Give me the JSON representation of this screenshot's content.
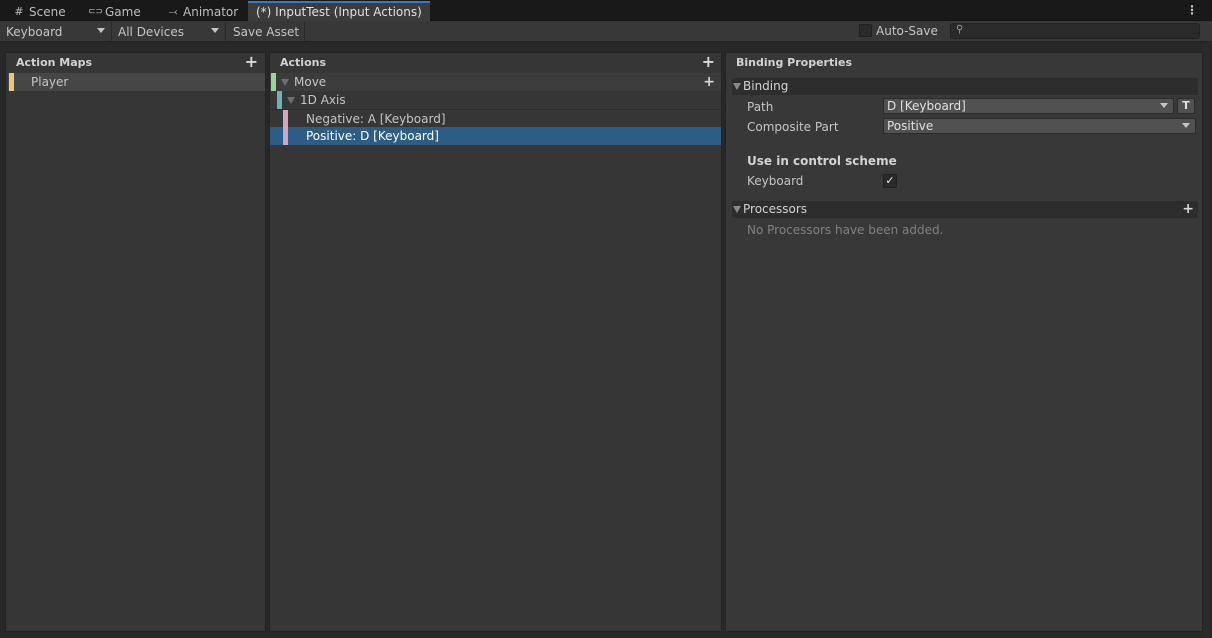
{
  "tabs": [
    {
      "icon": "#",
      "label": "Scene"
    },
    {
      "icon": "🎮",
      "label": "Game"
    },
    {
      "icon": "⤙",
      "label": "Animator"
    },
    {
      "icon": "",
      "label": "(*) InputTest (Input Actions)"
    }
  ],
  "toolbar": {
    "scheme_dropdown": "Keyboard",
    "device_dropdown": "All Devices",
    "save_button": "Save Asset",
    "autosave_label": "Auto-Save",
    "autosave_checked": false,
    "search_placeholder": ""
  },
  "action_maps": {
    "title": "Action Maps",
    "items": [
      {
        "label": "Player",
        "color": "#e8c97a"
      }
    ]
  },
  "actions": {
    "title": "Actions",
    "items": [
      {
        "label": "Move",
        "color": "#9ed19b"
      },
      {
        "label": "1D Axis",
        "color": "#6fb1b4"
      },
      {
        "label": "Negative: A [Keyboard]",
        "color": "#d4a4c0"
      },
      {
        "label": "Positive: D [Keyboard]",
        "color": "#d4a4c0",
        "selected": true
      }
    ]
  },
  "binding_properties": {
    "title": "Binding Properties",
    "binding_section": "Binding",
    "path_label": "Path",
    "path_value": "D [Keyboard]",
    "t_button": "T",
    "composite_label": "Composite Part",
    "composite_value": "Positive",
    "use_in_scheme_heading": "Use in control scheme",
    "scheme_keyboard_label": "Keyboard",
    "scheme_keyboard_checked": true,
    "processors_section": "Processors",
    "processors_empty": "No Processors have been added."
  },
  "colors": {
    "selection": "#2c5d87",
    "accent_tab": "#3a79bb"
  }
}
